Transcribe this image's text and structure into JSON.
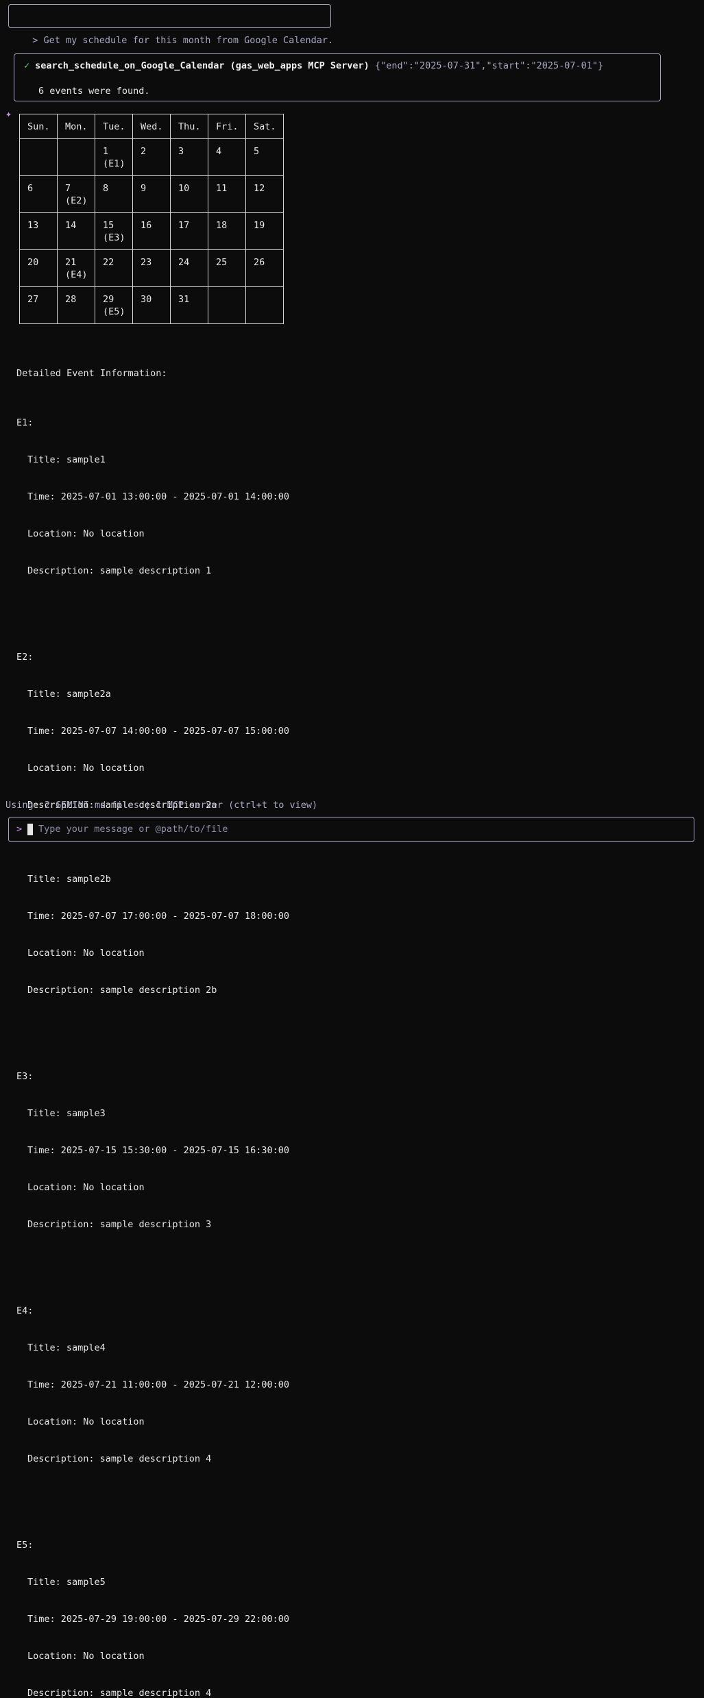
{
  "prompt": {
    "text": "> Get my schedule for this month from Google Calendar."
  },
  "tool_call": {
    "check": "✓",
    "name": "search_schedule_on_Google_Calendar (gas_web_apps MCP Server)",
    "args": "{\"end\":\"2025-07-31\",\"start\":\"2025-07-01\"}",
    "result": "6 events were found."
  },
  "sparkle": "✦",
  "calendar": {
    "headers": [
      "Sun.",
      "Mon.",
      "Tue.",
      "Wed.",
      "Thu.",
      "Fri.",
      "Sat."
    ],
    "weeks": [
      [
        "",
        "",
        "1\n(E1)",
        "2",
        "3",
        "4",
        "5"
      ],
      [
        "6",
        "7\n(E2)",
        "8",
        "9",
        "10",
        "11",
        "12"
      ],
      [
        "13",
        "14",
        "15\n(E3)",
        "16",
        "17",
        "18",
        "19"
      ],
      [
        "20",
        "21\n(E4)",
        "22",
        "23",
        "24",
        "25",
        "26"
      ],
      [
        "27",
        "28",
        "29\n(E5)",
        "30",
        "31",
        "",
        ""
      ]
    ]
  },
  "details": {
    "heading": "Detailed Event Information:",
    "events": [
      {
        "label": "E1:",
        "items": [
          {
            "title": "Title: sample1",
            "time": "Time: 2025-07-01 13:00:00 - 2025-07-01 14:00:00",
            "location": "Location: No location",
            "description": "Description: sample description 1"
          }
        ]
      },
      {
        "label": "E2:",
        "items": [
          {
            "title": "Title: sample2a",
            "time": "Time: 2025-07-07 14:00:00 - 2025-07-07 15:00:00",
            "location": "Location: No location",
            "description": "Description: sample description 2a"
          },
          {
            "title": "Title: sample2b",
            "time": "Time: 2025-07-07 17:00:00 - 2025-07-07 18:00:00",
            "location": "Location: No location",
            "description": "Description: sample description 2b"
          }
        ]
      },
      {
        "label": "E3:",
        "items": [
          {
            "title": "Title: sample3",
            "time": "Time: 2025-07-15 15:30:00 - 2025-07-15 16:30:00",
            "location": "Location: No location",
            "description": "Description: sample description 3"
          }
        ]
      },
      {
        "label": "E4:",
        "items": [
          {
            "title": "Title: sample4",
            "time": "Time: 2025-07-21 11:00:00 - 2025-07-21 12:00:00",
            "location": "Location: No location",
            "description": "Description: sample description 4"
          }
        ]
      },
      {
        "label": "E5:",
        "items": [
          {
            "title": "Title: sample5",
            "time": "Time: 2025-07-29 19:00:00 - 2025-07-29 22:00:00",
            "location": "Location: No location",
            "description": "Description: sample description 4"
          }
        ]
      }
    ]
  },
  "status": {
    "text": "Using: 2 GEMINI.md files ¦ 1 MCP server (ctrl+t to view)"
  },
  "input": {
    "prompt_symbol": ">",
    "placeholder": "Type your message or @path/to/file",
    "value": ""
  }
}
